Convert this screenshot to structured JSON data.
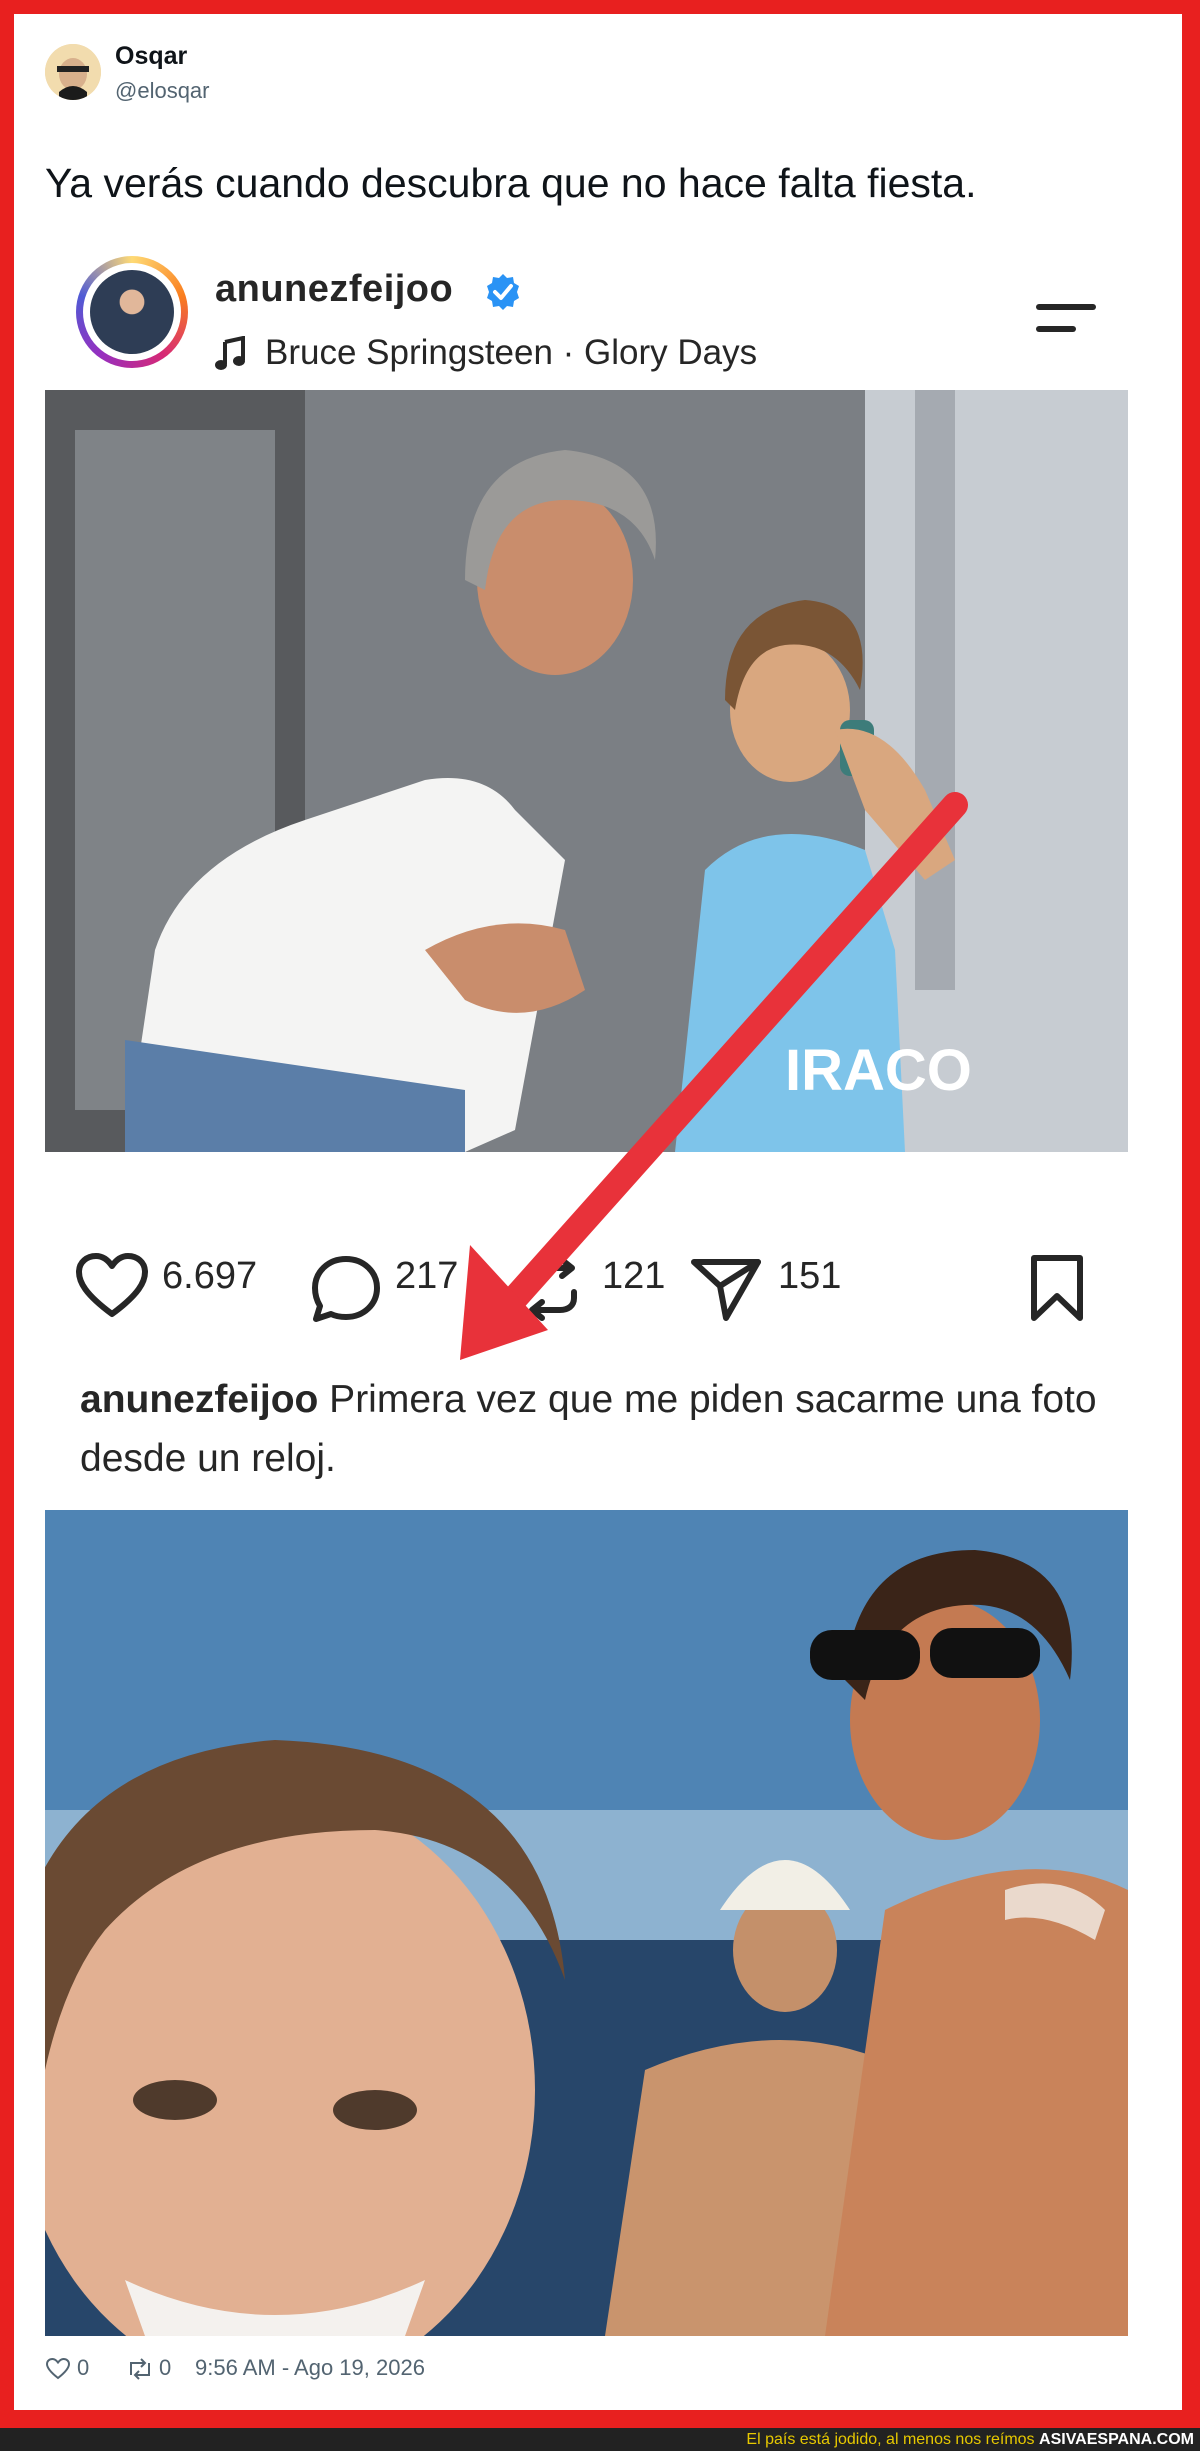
{
  "tweet": {
    "author_name": "Osqar",
    "author_handle": "@elosqar",
    "text": "Ya verás cuando descubra que no hace falta fiesta.",
    "likes": "0",
    "retweets": "0",
    "timestamp": "9:56 AM - Ago 19, 2026"
  },
  "instagram_post": {
    "username": "anunezfeijoo",
    "verified": true,
    "song": "Bruce Springsteen · Glory Days",
    "likes": "6.697",
    "comments": "217",
    "reposts": "121",
    "shares": "151",
    "caption_user": "anunezfeijoo",
    "caption_text": " Primera vez que me piden sacarme una foto desde un reloj.",
    "photo_text": "IRACO"
  },
  "icons": {
    "like": "heart-icon",
    "comment": "comment-bubble-icon",
    "repost": "repost-icon",
    "share": "paper-plane-icon",
    "bookmark": "bookmark-icon",
    "music": "music-note-icon",
    "menu": "menu-icon",
    "verified": "verified-badge-icon"
  },
  "colors": {
    "frame_red": "#e8201f",
    "verified_blue": "#2a93f5",
    "arrow_red": "#e8323a",
    "banner_yellow": "#e6c800"
  },
  "banner": {
    "slogan": "El país está jodido, al menos nos reímos",
    "site": "ASIVAESPANA.COM"
  }
}
